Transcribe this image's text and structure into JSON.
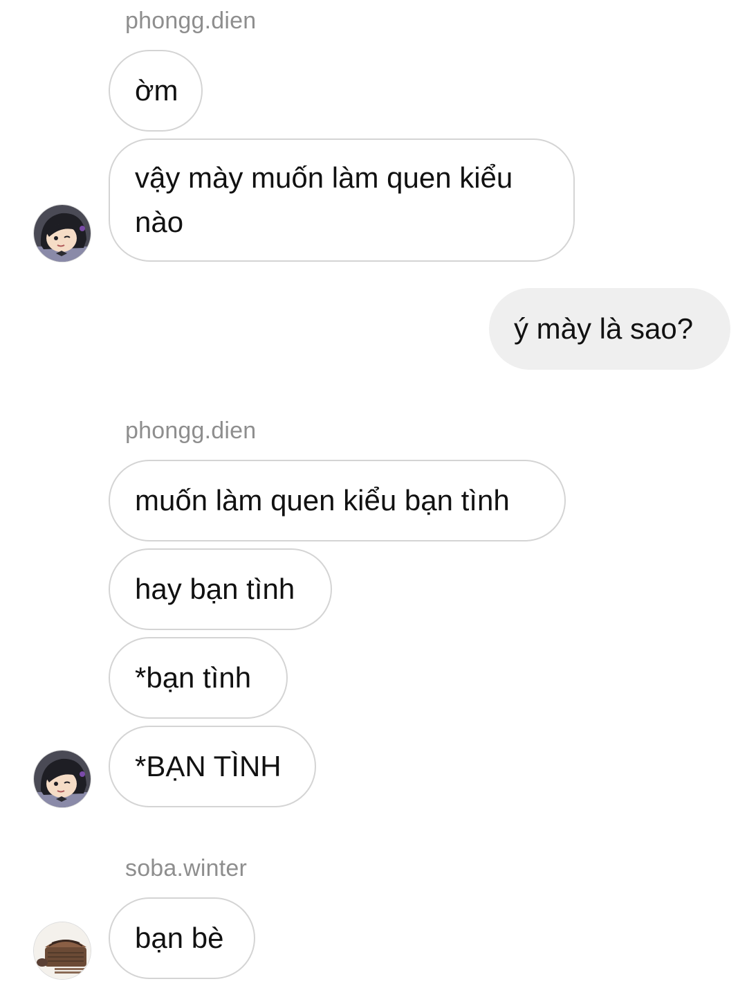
{
  "messages": {
    "group1_sender": "phongg.dien",
    "group1_msg1": "ờm",
    "group1_msg2": "vậy mày muốn làm quen kiểu nào",
    "mine_msg1": "ý mày là sao?",
    "group2_sender": "phongg.dien",
    "group2_msg1": "muốn làm quen kiểu bạn tình",
    "group2_msg2": "hay bạn tình",
    "group2_msg3": "*bạn tình",
    "group2_msg4": "*BẠN TÌNH",
    "group3_sender": "soba.winter",
    "group3_msg1": "bạn bè"
  },
  "icons": {
    "avatar_phongg": "cartoon-character-avatar-icon",
    "avatar_soba": "noodle-bowl-avatar-icon"
  },
  "colors": {
    "bubble_border": "#d4d4d4",
    "mine_bubble_bg": "#efefef",
    "sender_text": "#8e8e8e"
  }
}
